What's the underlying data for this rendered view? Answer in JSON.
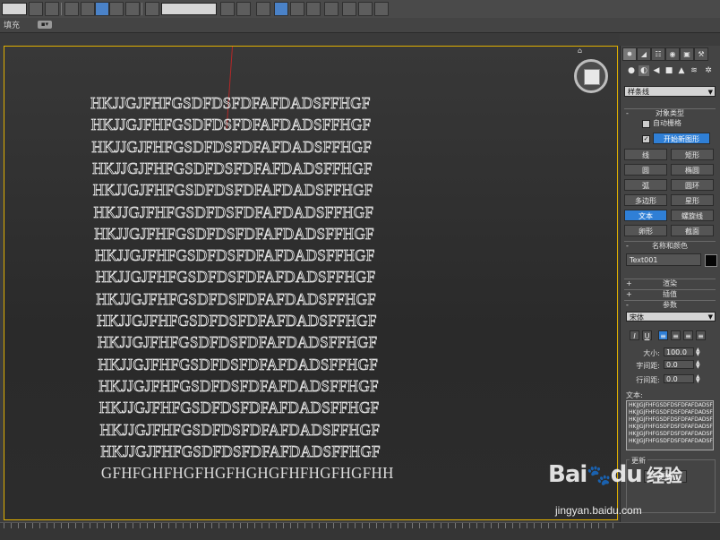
{
  "toolbar": {
    "named_selection_value": "",
    "field2_value": ""
  },
  "subbar": {
    "fill_label": "填充"
  },
  "viewport": {
    "text_lines": [
      "HKJJGJFHFGSDFDSFDFAFDADSFFHGF",
      "HKJJGJFHFGSDFDSFDFAFDADSFFHGF",
      "HKJJGJFHFGSDFDSFDFAFDADSFFHGF",
      "HKJJGJFHFGSDFDSFDFAFDADSFFHGF",
      "HKJJGJFHFGSDFDSFDFAFDADSFFHGF",
      "HKJJGJFHFGSDFDSFDFAFDADSFFHGF",
      "HKJJGJFHFGSDFDSFDFAFDADSFFHGF",
      "HKJJGJFHFGSDFDSFDFAFDADSFFHGF",
      "HKJJGJFHFGSDFDSFDFAFDADSFFHGF",
      "HKJJGJFHFGSDFDSFDFAFDADSFFHGF",
      "HKJJGJFHFGSDFDSFDFAFDADSFFHGF",
      "HKJJGJFHFGSDFDSFDFAFDADSFFHGF",
      "HKJJGJFHFGSDFDSFDFAFDADSFFHGF",
      "HKJJGJFHFGSDFDSFDFAFDADSFFHGF",
      "HKJJGJFHFGSDFDSFDFAFDADSFFHGF",
      "HKJJGJFHFGSDFDSFDFAFDADSFFHGF",
      "HKJJGJFHFGSDFDSFDFAFDADSFFHGF",
      "GFHFGHFHGFHGFHGHGFHFHGFHGFHH"
    ]
  },
  "panel": {
    "category_dropdown": "样条线",
    "object_type_title": "对象类型",
    "auto_grid_label": "自动栅格",
    "start_new_shape_label": "开始新图形",
    "start_new_shape_checked": true,
    "shape_buttons": [
      {
        "left": "线",
        "right": "矩形"
      },
      {
        "left": "圆",
        "right": "椭圆"
      },
      {
        "left": "弧",
        "right": "圆环"
      },
      {
        "left": "多边形",
        "right": "星形"
      },
      {
        "left": "文本",
        "right": "螺旋线"
      },
      {
        "left": "卵形",
        "right": "截面"
      }
    ],
    "active_shape": "文本",
    "name_color_title": "名称和颜色",
    "object_name": "Text001",
    "object_color": "#050505",
    "render_title": "渲染",
    "interpolation_title": "插值",
    "parameters_title": "参数",
    "font_value": "宋体",
    "format_buttons": {
      "italic": "I",
      "underline": "U",
      "align_left": "≡",
      "align_center": "≡",
      "align_right": "≡",
      "justify": "≡"
    },
    "size_label": "大小:",
    "size_value": "100.0",
    "kerning_label": "字间距:",
    "kerning_value": "0.0",
    "leading_label": "行间距:",
    "leading_value": "0.0",
    "text_label": "文本:",
    "text_content_lines": [
      "HKJJGJFHFGSDFDSFDFAFDADSFFH",
      "HKJJGJFHFGSDFDSFDFAFDADSFFH",
      "HKJJGJFHFGSDFDSFDFAFDADSFFH",
      "HKJJGJFHFGSDFDSFDFAFDADSFFH",
      "HKJJGJFHFGSDFDSFDFAFDADSFFH",
      "HKJJGJFHFGSDFDSFDFAFDADSFFH"
    ],
    "update_group_label": "更新",
    "update_button": "更新"
  },
  "watermark": {
    "logo_bai": "Bai",
    "logo_du": "du",
    "logo_cn": "经验",
    "url": "jingyan.baidu.com"
  },
  "colors": {
    "accent_blue": "#2f7fd6",
    "viewport_border": "#e0b000"
  }
}
